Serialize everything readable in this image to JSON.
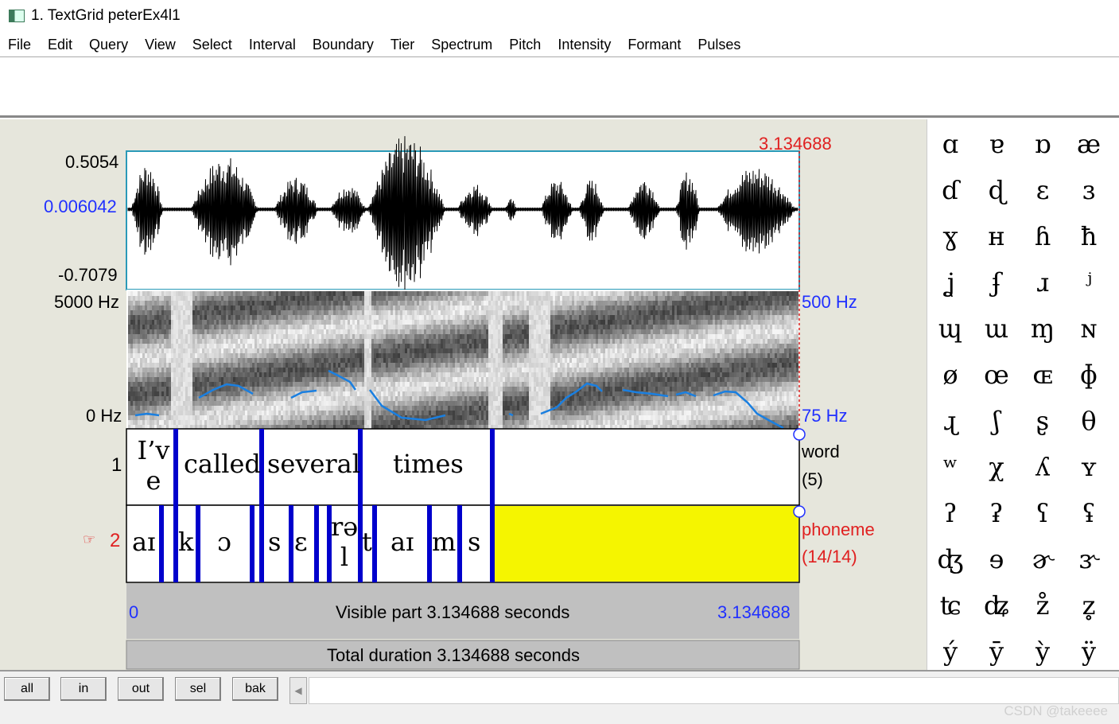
{
  "window": {
    "title": "1. TextGrid peterEx4l1"
  },
  "menu": [
    "File",
    "Edit",
    "Query",
    "View",
    "Select",
    "Interval",
    "Boundary",
    "Tier",
    "Spectrum",
    "Pitch",
    "Intensity",
    "Formant",
    "Pulses"
  ],
  "waveform": {
    "max_label": "0.5054",
    "cursor_value": "0.006042",
    "min_label": "-0.7079",
    "cursor_time": "3.134688"
  },
  "spectrogram": {
    "top_label": "5000 Hz",
    "bottom_label": "0 Hz",
    "pitch_top": "500 Hz",
    "pitch_bottom": "75 Hz"
  },
  "tiers": {
    "tier1": {
      "number": "1",
      "name": "word",
      "count": "(5)",
      "intervals": [
        "I’v e",
        "called",
        "several",
        "times",
        ""
      ]
    },
    "tier2": {
      "number": "2",
      "pointer": "☞",
      "name": "phoneme",
      "count": "(14/14)",
      "intervals": [
        "aɪ",
        "k",
        "ɔ",
        "",
        "s",
        "ɛ",
        "",
        "rə l",
        "t",
        "aɪ",
        "m",
        "s",
        ""
      ]
    }
  },
  "time_axis": {
    "start": "0",
    "visible": "Visible part 3.134688 seconds",
    "end": "3.134688",
    "total": "Total duration 3.134688 seconds"
  },
  "buttons": {
    "all": "all",
    "in": "in",
    "out": "out",
    "sel": "sel",
    "bak": "bak"
  },
  "ipa": [
    "ɑ",
    "ɐ",
    "ɒ",
    "æ",
    "ɗ",
    "ɖ",
    "ɛ",
    "ɜ",
    "ɣ",
    "ʜ",
    "ɦ",
    "ħ",
    "ʝ",
    "ʄ",
    "ɹ",
    "ʲ",
    "ɰ",
    "ɯ",
    "ɱ",
    "ɴ",
    "ø",
    "œ",
    "ɶ",
    "ɸ",
    "ɻ",
    "ʃ",
    "ʂ",
    "θ",
    "ʷ",
    "χ",
    "ʎ",
    "ʏ",
    "ʔ",
    "ʡ",
    "ʕ",
    "ʢ",
    "ʤ",
    "ɘ",
    "ɚ",
    "ɝ",
    "ʨ",
    "ʥ",
    "z̊",
    "z̥",
    "ý",
    "ȳ",
    "ỳ",
    "ÿ"
  ],
  "watermark": "CSDN @takeeee",
  "colors": {
    "selection": "#f5f500",
    "boundary": "#0000cc",
    "pitch": "#1a7fe0",
    "cursor": "#e02020",
    "axis_blue": "#2030ff"
  }
}
